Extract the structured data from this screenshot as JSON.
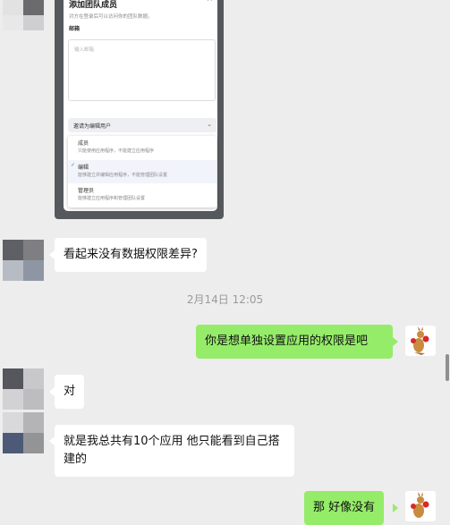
{
  "screenshot": {
    "title": "添加团队成员",
    "subtitle": "对方在登录后可以访问你的团队数据。",
    "email_label": "邮箱",
    "email_placeholder": "输入邮箱",
    "role_select": "邀请为编辑用户",
    "close_glyph": "×",
    "options": [
      {
        "title": "成员",
        "desc": "只能使用应用程序，不能建立应用程序",
        "selected": false
      },
      {
        "title": "编辑",
        "desc": "能够建立并编辑应用程序，不能管理团队设置",
        "selected": true
      },
      {
        "title": "管理员",
        "desc": "能够建立应用程序和管理团队设置",
        "selected": false
      }
    ]
  },
  "messages": [
    {
      "side": "left",
      "text": "看起来没有数据权限差异?"
    },
    {
      "side": "right",
      "text": "你是想单独设置应用的权限是吧"
    },
    {
      "side": "left",
      "text": "对"
    },
    {
      "side": "left",
      "text": "就是我总共有10个应用 他只能看到自己搭建的"
    },
    {
      "side": "right",
      "text": "那 好像没有"
    }
  ],
  "timestamp": "2月14日 12:05",
  "colors": {
    "background": "#ededed",
    "bubble_left": "#ffffff",
    "bubble_right": "#95ec69",
    "timestamp": "#9a9a9a"
  },
  "icons": {
    "contact_avatar": "pixelated-avatar",
    "self_avatar": "kangaroo-boxing-avatar",
    "check": "checkmark-icon",
    "chevron": "chevron-down-icon"
  }
}
